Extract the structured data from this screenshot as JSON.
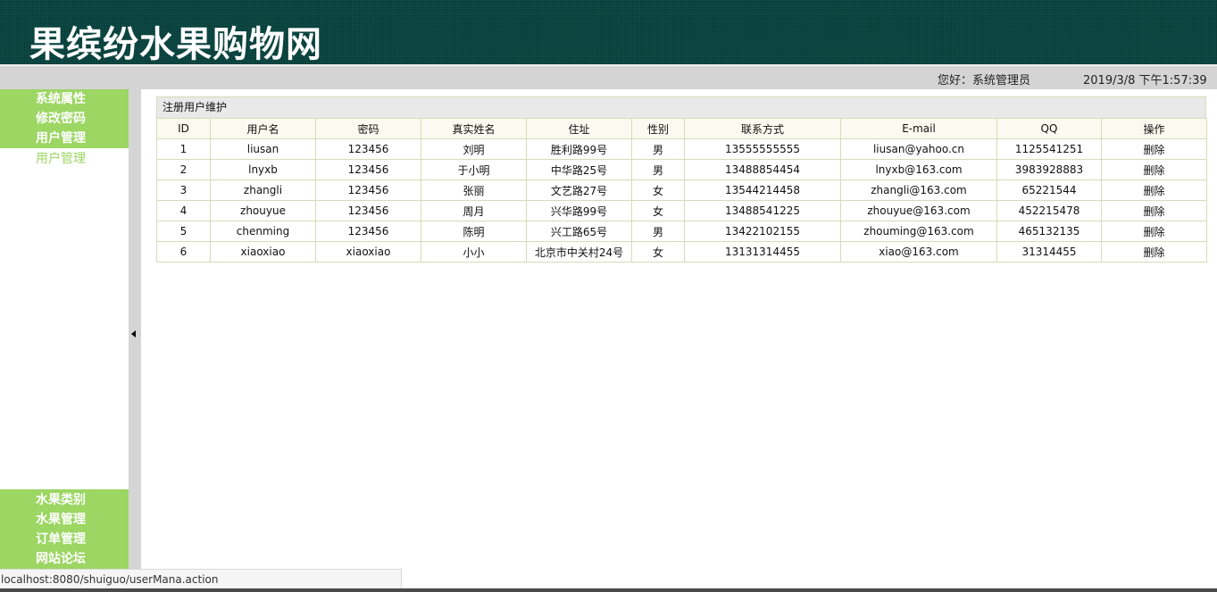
{
  "header": {
    "site_title": "果缤纷水果购物网"
  },
  "infobar": {
    "greeting": "您好：系统管理员",
    "datetime": "2019/3/8 下午1:57:39"
  },
  "sidebar": {
    "top_items": [
      "系统属性",
      "修改密码",
      "用户管理"
    ],
    "sub_item": "用户管理",
    "bottom_items": [
      "水果类别",
      "水果管理",
      "订单管理",
      "网站论坛"
    ]
  },
  "panel": {
    "title": "注册用户维护"
  },
  "table": {
    "headers": [
      "ID",
      "用户名",
      "密码",
      "真实姓名",
      "住址",
      "性别",
      "联系方式",
      "E-mail",
      "QQ",
      "操作"
    ],
    "rows": [
      [
        "1",
        "liusan",
        "123456",
        "刘明",
        "胜利路99号",
        "男",
        "13555555555",
        "liusan@yahoo.cn",
        "1125541251",
        "删除"
      ],
      [
        "2",
        "lnyxb",
        "123456",
        "于小明",
        "中华路25号",
        "男",
        "13488854454",
        "lnyxb@163.com",
        "3983928883",
        "删除"
      ],
      [
        "3",
        "zhangli",
        "123456",
        "张丽",
        "文艺路27号",
        "女",
        "13544214458",
        "zhangli@163.com",
        "65221544",
        "删除"
      ],
      [
        "4",
        "zhouyue",
        "123456",
        "周月",
        "兴华路99号",
        "女",
        "13488541225",
        "zhouyue@163.com",
        "452215478",
        "删除"
      ],
      [
        "5",
        "chenming",
        "123456",
        "陈明",
        "兴工路65号",
        "男",
        "13422102155",
        "zhouming@163.com",
        "465132135",
        "删除"
      ],
      [
        "6",
        "xiaoxiao",
        "xiaoxiao",
        "小小",
        "北京市中关村24号",
        "女",
        "13131314455",
        "xiao@163.com",
        "31314455",
        "删除"
      ]
    ]
  },
  "statusbar": {
    "url": "localhost:8080/shuiguo/userMana.action"
  },
  "colors": {
    "header_bg": "#0d4a45",
    "menu_green": "#9cd663",
    "infobar_bg": "#d4d4d4",
    "grid_border": "#d5dcb8"
  }
}
